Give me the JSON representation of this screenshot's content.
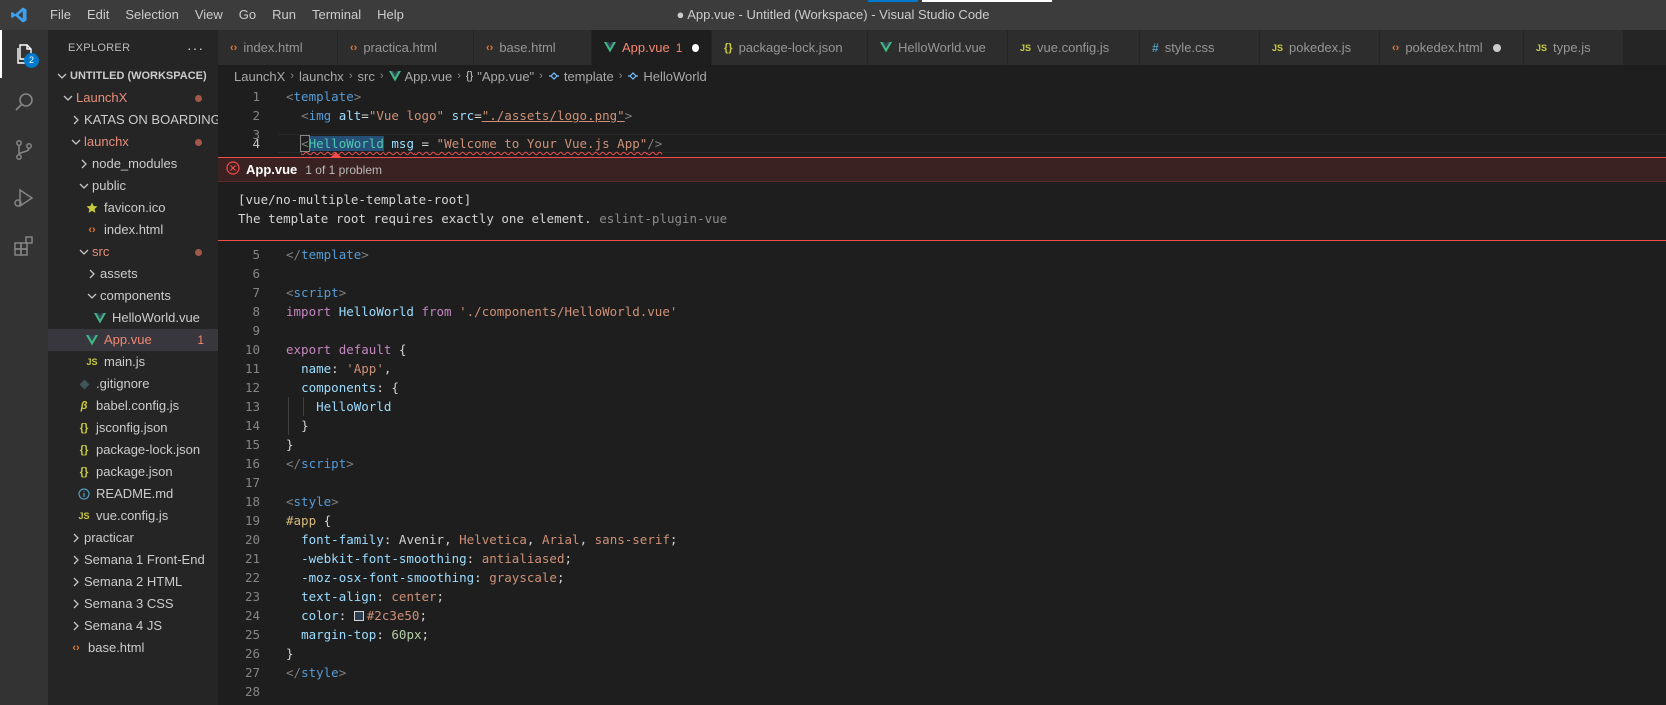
{
  "window": {
    "title": "● App.vue - Untitled (Workspace) - Visual Studio Code",
    "menu": [
      "File",
      "Edit",
      "Selection",
      "View",
      "Go",
      "Run",
      "Terminal",
      "Help"
    ]
  },
  "activity": {
    "explorer_badge": "2"
  },
  "sidebar": {
    "header": "EXPLORER",
    "more": "···",
    "workspace": "UNTITLED (WORKSPACE)",
    "items": [
      {
        "label": "LaunchX"
      },
      {
        "label": "KATAS ON BOARDING"
      },
      {
        "label": "launchx"
      },
      {
        "label": "node_modules"
      },
      {
        "label": "public"
      },
      {
        "label": "favicon.ico"
      },
      {
        "label": "index.html"
      },
      {
        "label": "src"
      },
      {
        "label": "assets"
      },
      {
        "label": "components"
      },
      {
        "label": "HelloWorld.vue"
      },
      {
        "label": "App.vue",
        "count": "1"
      },
      {
        "label": "main.js"
      },
      {
        "label": ".gitignore"
      },
      {
        "label": "babel.config.js"
      },
      {
        "label": "jsconfig.json"
      },
      {
        "label": "package-lock.json"
      },
      {
        "label": "package.json"
      },
      {
        "label": "README.md"
      },
      {
        "label": "vue.config.js"
      },
      {
        "label": "practicar"
      },
      {
        "label": "Semana 1 Front-End"
      },
      {
        "label": "Semana 2 HTML"
      },
      {
        "label": "Semana 3 CSS"
      },
      {
        "label": "Semana 4 JS"
      },
      {
        "label": "base.html"
      }
    ]
  },
  "tabs": [
    {
      "label": "index.html"
    },
    {
      "label": "practica.html"
    },
    {
      "label": "base.html"
    },
    {
      "label": "App.vue",
      "count": "1"
    },
    {
      "label": "package-lock.json"
    },
    {
      "label": "HelloWorld.vue"
    },
    {
      "label": "vue.config.js"
    },
    {
      "label": "style.css"
    },
    {
      "label": "pokedex.js"
    },
    {
      "label": "pokedex.html"
    },
    {
      "label": "type.js"
    }
  ],
  "breadcrumb": [
    "LaunchX",
    "launchx",
    "src",
    "App.vue",
    "\"App.vue\"",
    "template",
    "HelloWorld"
  ],
  "problem": {
    "file": "App.vue",
    "count": "1 of 1 problem",
    "rule": "[vue/no-multiple-template-root]",
    "message": "The template root requires exactly one element.",
    "source": "eslint-plugin-vue"
  },
  "code": {
    "line_numbers": [
      "1",
      "2",
      "3",
      "4",
      "5",
      "6",
      "7",
      "8",
      "9",
      "10",
      "11",
      "12",
      "13",
      "14",
      "15",
      "16",
      "17",
      "18",
      "19",
      "20",
      "21",
      "22",
      "23",
      "24",
      "25",
      "26",
      "27",
      "28"
    ],
    "l1_open": "<",
    "l1_tag": "template",
    "l1_close": ">",
    "l2_open": "<",
    "l2_tag": "img",
    "l2_attr1": "alt",
    "l2_eq1": "=",
    "l2_val1": "\"Vue logo\"",
    "l2_attr2": "src",
    "l2_eq2": "=",
    "l2_val2": "\"./assets/logo.png\"",
    "l2_close": ">",
    "l4_open": "<",
    "l4_comp": "HelloWorld",
    "l4_attr": "msg",
    "l4_eq": " = ",
    "l4_val": "\"Welcome to Your Vue.js App\"",
    "l4_close": "/>",
    "l5_open": "</",
    "l5_tag": "template",
    "l5_close": ">",
    "l7_open": "<",
    "l7_tag": "script",
    "l7_close": ">",
    "l8_kw": "import",
    "l8_var": "HelloWorld",
    "l8_from": "from",
    "l8_str": "'./components/HelloWorld.vue'",
    "l10_kw": "export",
    "l10_kw2": "default",
    "l10_brace": "{",
    "l11_prop": "name",
    "l11_colon": ":",
    "l11_str": "'App'",
    "l11_comma": ",",
    "l12_prop": "components",
    "l12_rest": ": {",
    "l13_var": "HelloWorld",
    "l14": "}",
    "l15": "}",
    "l16_open": "</",
    "l16_tag": "script",
    "l16_close": ">",
    "l18_open": "<",
    "l18_tag": "style",
    "l18_close": ">",
    "l19_sel": "#app",
    "l19_brace": "{",
    "l20_prop": "font-family",
    "l20_colon": ":",
    "l20_v1": "Avenir",
    "l20_c1": ",",
    "l20_v2": "Helvetica",
    "l20_c2": ",",
    "l20_v3": "Arial",
    "l20_c3": ",",
    "l20_v4": "sans-serif",
    "l20_semi": ";",
    "l21_prop": "-webkit-font-smoothing",
    "l21_colon": ":",
    "l21_val": "antialiased",
    "l21_semi": ";",
    "l22_prop": "-moz-osx-font-smoothing",
    "l22_colon": ":",
    "l22_val": "grayscale",
    "l22_semi": ";",
    "l23_prop": "text-align",
    "l23_colon": ":",
    "l23_val": "center",
    "l23_semi": ";",
    "l24_prop": "color",
    "l24_colon": ":",
    "l24_val": "#2c3e50",
    "l24_semi": ";",
    "l25_prop": "margin-top",
    "l25_colon": ":",
    "l25_val": "60px",
    "l25_semi": ";",
    "l26": "}",
    "l27_open": "</",
    "l27_tag": "style",
    "l27_close": ">"
  },
  "colors": {
    "error": "#f14c4c",
    "accent": "#007acc",
    "vue_green": "#41b883",
    "js_yellow": "#cbcb41",
    "html_orange": "#e37933",
    "css_blue": "#519aba",
    "swatch": "#2c3e50"
  }
}
